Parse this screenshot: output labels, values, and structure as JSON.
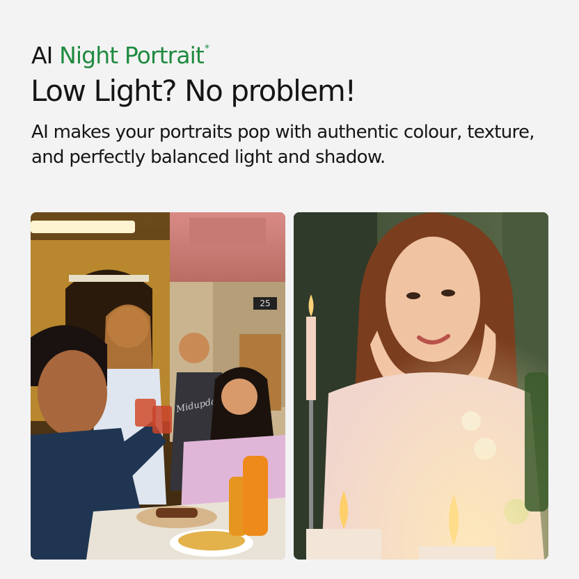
{
  "eyebrow": {
    "prefix": "AI",
    "title": "Night Portrait",
    "mark": "*"
  },
  "headline": "Low Light? No problem!",
  "subcopy": "AI makes your portraits pop with authentic colour, texture, and perfectly balanced light and shadow.",
  "photos": {
    "left": {
      "door_number": "25",
      "sweater_text": "Midupdate"
    },
    "right": {}
  },
  "colors": {
    "background": "#f3f3f3",
    "accent_green": "#1f8a3f",
    "text": "#151515"
  }
}
